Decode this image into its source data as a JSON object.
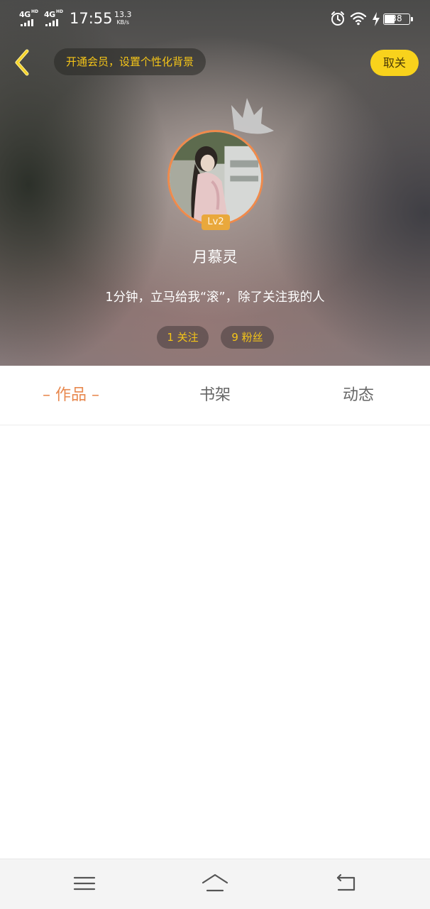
{
  "status_bar": {
    "network_1": "4G",
    "network_2": "4G",
    "time": "17:55",
    "speed_value": "13.3",
    "speed_unit": "KB/s",
    "battery_level": "38",
    "icons": [
      "alarm-icon",
      "wifi-icon",
      "charging-icon",
      "battery-icon"
    ]
  },
  "header": {
    "vip_banner": "开通会员，设置个性化背景",
    "follow_button": "取关",
    "level_badge": "Lv2",
    "username": "月慕灵",
    "bio": "1分钟，立马给我“滚”，除了关注我的人",
    "following": "1 关注",
    "fans": "9 粉丝"
  },
  "tabs": {
    "works": "作品",
    "bookshelf": "书架",
    "activity": "动态"
  },
  "colors": {
    "accent_yellow": "#f8d21c",
    "accent_orange": "#e8884e",
    "level_badge": "#e9a83c",
    "pill_text": "#f5c518"
  }
}
